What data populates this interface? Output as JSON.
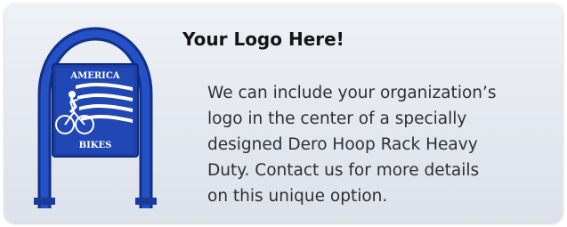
{
  "card": {
    "heading": "Your Logo Here!",
    "body_lines": [
      "We can include your organization’s",
      "logo in the center of a specially",
      "designed Dero Hoop Rack Heavy",
      "Duty.  Contact us for more details",
      "on this unique option."
    ]
  },
  "image": {
    "icon": "bike-rack-image",
    "logo_top_text": "AMERICA",
    "logo_bottom_text": "BIKES",
    "rack_color": "#1b3fa8"
  }
}
